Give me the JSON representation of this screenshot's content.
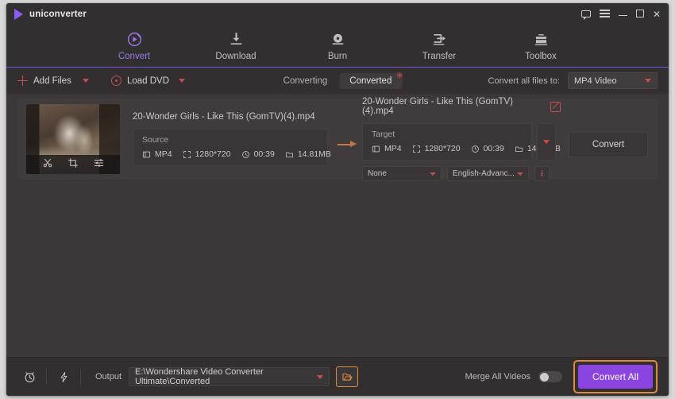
{
  "app": {
    "name": "uniconverter",
    "logo_icon": "play-triangle-icon"
  },
  "titlebar": {
    "controls": [
      {
        "name": "feedback-icon",
        "label": "feedback"
      },
      {
        "name": "menu-icon",
        "label": "menu"
      },
      {
        "name": "minimize-icon",
        "label": "minimize"
      },
      {
        "name": "maximize-icon",
        "label": "maximize"
      },
      {
        "name": "close-icon",
        "label": "✕"
      }
    ]
  },
  "nav": {
    "active": "Convert",
    "items": [
      {
        "label": "Convert",
        "icon": "convert-circle-play-icon"
      },
      {
        "label": "Download",
        "icon": "download-arrow-icon"
      },
      {
        "label": "Burn",
        "icon": "burn-disc-icon"
      },
      {
        "label": "Transfer",
        "icon": "transfer-arrow-icon"
      },
      {
        "label": "Toolbox",
        "icon": "toolbox-icon"
      }
    ]
  },
  "toolbar": {
    "add_files_label": "Add Files",
    "load_dvd_label": "Load DVD",
    "tabs": [
      {
        "label": "Converting",
        "active": false,
        "badge": ""
      },
      {
        "label": "Converted",
        "active": true,
        "badge": "✳"
      }
    ],
    "convert_all_to_label": "Convert all files to:",
    "convert_all_to_value": "MP4 Video"
  },
  "file": {
    "thumbnail_tools": [
      {
        "name": "trim-scissors-icon"
      },
      {
        "name": "crop-icon"
      },
      {
        "name": "effects-sliders-icon"
      }
    ],
    "source": {
      "filename": "20-Wonder Girls - Like This (GomTV)(4).mp4",
      "caption": "Source",
      "format": "MP4",
      "resolution": "1280*720",
      "duration": "00:39",
      "size": "14.81MB"
    },
    "target": {
      "filename": "20-Wonder Girls - Like This (GomTV)(4).mp4",
      "caption": "Target",
      "format": "MP4",
      "resolution": "1280*720",
      "duration": "00:39",
      "size": "14.72MB",
      "subtitle_value": "None",
      "audio_value": "English-Advanc...",
      "info_label": "i"
    },
    "convert_button_label": "Convert"
  },
  "bottom": {
    "output_label": "Output",
    "output_path": "E:\\Wondershare Video Converter Ultimate\\Converted",
    "merge_label": "Merge All Videos",
    "merge_enabled": false,
    "convert_all_label": "Convert All"
  },
  "colors": {
    "accent_purple": "#8b44df",
    "accent_orange": "#e08a3c",
    "accent_red": "#c0504d",
    "nav_underline": "#7c52d6"
  }
}
